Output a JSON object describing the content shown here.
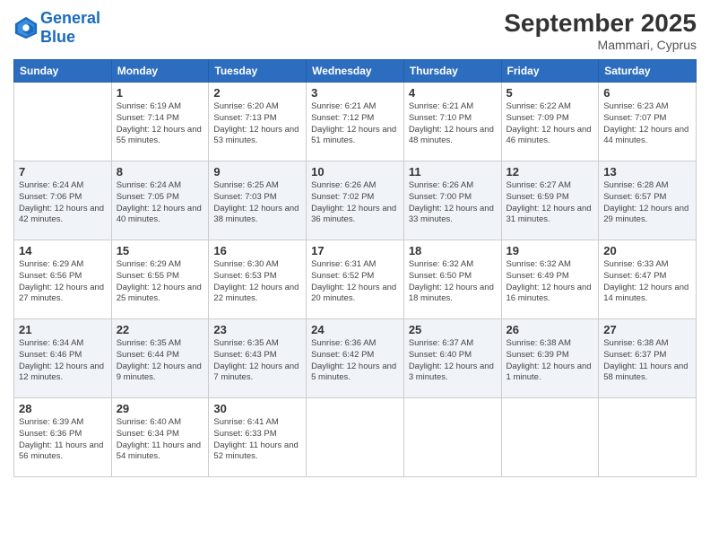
{
  "header": {
    "logo_line1": "General",
    "logo_line2": "Blue",
    "month": "September 2025",
    "location": "Mammari, Cyprus"
  },
  "weekdays": [
    "Sunday",
    "Monday",
    "Tuesday",
    "Wednesday",
    "Thursday",
    "Friday",
    "Saturday"
  ],
  "weeks": [
    [
      {
        "day": "",
        "sunrise": "",
        "sunset": "",
        "daylight": ""
      },
      {
        "day": "1",
        "sunrise": "Sunrise: 6:19 AM",
        "sunset": "Sunset: 7:14 PM",
        "daylight": "Daylight: 12 hours and 55 minutes."
      },
      {
        "day": "2",
        "sunrise": "Sunrise: 6:20 AM",
        "sunset": "Sunset: 7:13 PM",
        "daylight": "Daylight: 12 hours and 53 minutes."
      },
      {
        "day": "3",
        "sunrise": "Sunrise: 6:21 AM",
        "sunset": "Sunset: 7:12 PM",
        "daylight": "Daylight: 12 hours and 51 minutes."
      },
      {
        "day": "4",
        "sunrise": "Sunrise: 6:21 AM",
        "sunset": "Sunset: 7:10 PM",
        "daylight": "Daylight: 12 hours and 48 minutes."
      },
      {
        "day": "5",
        "sunrise": "Sunrise: 6:22 AM",
        "sunset": "Sunset: 7:09 PM",
        "daylight": "Daylight: 12 hours and 46 minutes."
      },
      {
        "day": "6",
        "sunrise": "Sunrise: 6:23 AM",
        "sunset": "Sunset: 7:07 PM",
        "daylight": "Daylight: 12 hours and 44 minutes."
      }
    ],
    [
      {
        "day": "7",
        "sunrise": "Sunrise: 6:24 AM",
        "sunset": "Sunset: 7:06 PM",
        "daylight": "Daylight: 12 hours and 42 minutes."
      },
      {
        "day": "8",
        "sunrise": "Sunrise: 6:24 AM",
        "sunset": "Sunset: 7:05 PM",
        "daylight": "Daylight: 12 hours and 40 minutes."
      },
      {
        "day": "9",
        "sunrise": "Sunrise: 6:25 AM",
        "sunset": "Sunset: 7:03 PM",
        "daylight": "Daylight: 12 hours and 38 minutes."
      },
      {
        "day": "10",
        "sunrise": "Sunrise: 6:26 AM",
        "sunset": "Sunset: 7:02 PM",
        "daylight": "Daylight: 12 hours and 36 minutes."
      },
      {
        "day": "11",
        "sunrise": "Sunrise: 6:26 AM",
        "sunset": "Sunset: 7:00 PM",
        "daylight": "Daylight: 12 hours and 33 minutes."
      },
      {
        "day": "12",
        "sunrise": "Sunrise: 6:27 AM",
        "sunset": "Sunset: 6:59 PM",
        "daylight": "Daylight: 12 hours and 31 minutes."
      },
      {
        "day": "13",
        "sunrise": "Sunrise: 6:28 AM",
        "sunset": "Sunset: 6:57 PM",
        "daylight": "Daylight: 12 hours and 29 minutes."
      }
    ],
    [
      {
        "day": "14",
        "sunrise": "Sunrise: 6:29 AM",
        "sunset": "Sunset: 6:56 PM",
        "daylight": "Daylight: 12 hours and 27 minutes."
      },
      {
        "day": "15",
        "sunrise": "Sunrise: 6:29 AM",
        "sunset": "Sunset: 6:55 PM",
        "daylight": "Daylight: 12 hours and 25 minutes."
      },
      {
        "day": "16",
        "sunrise": "Sunrise: 6:30 AM",
        "sunset": "Sunset: 6:53 PM",
        "daylight": "Daylight: 12 hours and 22 minutes."
      },
      {
        "day": "17",
        "sunrise": "Sunrise: 6:31 AM",
        "sunset": "Sunset: 6:52 PM",
        "daylight": "Daylight: 12 hours and 20 minutes."
      },
      {
        "day": "18",
        "sunrise": "Sunrise: 6:32 AM",
        "sunset": "Sunset: 6:50 PM",
        "daylight": "Daylight: 12 hours and 18 minutes."
      },
      {
        "day": "19",
        "sunrise": "Sunrise: 6:32 AM",
        "sunset": "Sunset: 6:49 PM",
        "daylight": "Daylight: 12 hours and 16 minutes."
      },
      {
        "day": "20",
        "sunrise": "Sunrise: 6:33 AM",
        "sunset": "Sunset: 6:47 PM",
        "daylight": "Daylight: 12 hours and 14 minutes."
      }
    ],
    [
      {
        "day": "21",
        "sunrise": "Sunrise: 6:34 AM",
        "sunset": "Sunset: 6:46 PM",
        "daylight": "Daylight: 12 hours and 12 minutes."
      },
      {
        "day": "22",
        "sunrise": "Sunrise: 6:35 AM",
        "sunset": "Sunset: 6:44 PM",
        "daylight": "Daylight: 12 hours and 9 minutes."
      },
      {
        "day": "23",
        "sunrise": "Sunrise: 6:35 AM",
        "sunset": "Sunset: 6:43 PM",
        "daylight": "Daylight: 12 hours and 7 minutes."
      },
      {
        "day": "24",
        "sunrise": "Sunrise: 6:36 AM",
        "sunset": "Sunset: 6:42 PM",
        "daylight": "Daylight: 12 hours and 5 minutes."
      },
      {
        "day": "25",
        "sunrise": "Sunrise: 6:37 AM",
        "sunset": "Sunset: 6:40 PM",
        "daylight": "Daylight: 12 hours and 3 minutes."
      },
      {
        "day": "26",
        "sunrise": "Sunrise: 6:38 AM",
        "sunset": "Sunset: 6:39 PM",
        "daylight": "Daylight: 12 hours and 1 minute."
      },
      {
        "day": "27",
        "sunrise": "Sunrise: 6:38 AM",
        "sunset": "Sunset: 6:37 PM",
        "daylight": "Daylight: 11 hours and 58 minutes."
      }
    ],
    [
      {
        "day": "28",
        "sunrise": "Sunrise: 6:39 AM",
        "sunset": "Sunset: 6:36 PM",
        "daylight": "Daylight: 11 hours and 56 minutes."
      },
      {
        "day": "29",
        "sunrise": "Sunrise: 6:40 AM",
        "sunset": "Sunset: 6:34 PM",
        "daylight": "Daylight: 11 hours and 54 minutes."
      },
      {
        "day": "30",
        "sunrise": "Sunrise: 6:41 AM",
        "sunset": "Sunset: 6:33 PM",
        "daylight": "Daylight: 11 hours and 52 minutes."
      },
      {
        "day": "",
        "sunrise": "",
        "sunset": "",
        "daylight": ""
      },
      {
        "day": "",
        "sunrise": "",
        "sunset": "",
        "daylight": ""
      },
      {
        "day": "",
        "sunrise": "",
        "sunset": "",
        "daylight": ""
      },
      {
        "day": "",
        "sunrise": "",
        "sunset": "",
        "daylight": ""
      }
    ]
  ]
}
